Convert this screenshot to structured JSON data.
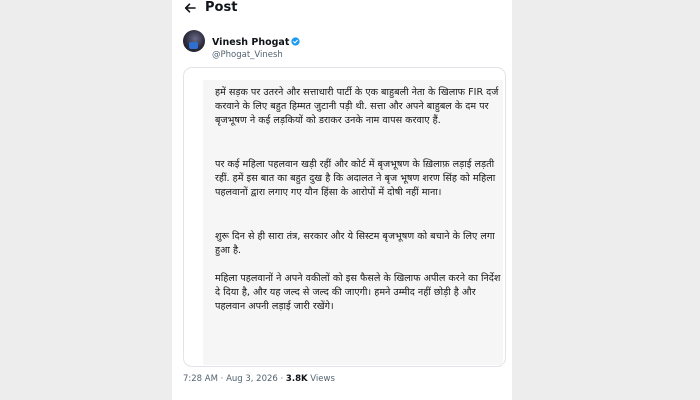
{
  "header": {
    "title": "Post"
  },
  "author": {
    "name": "Vinesh Phogat",
    "handle": "@Phogat_Vinesh"
  },
  "post": {
    "paragraphs": [
      "हमें सड़क पर उतरने और सत्ताधारी पार्टी के एक बाहुबली नेता के खिलाफ FIR दर्ज करवाने के लिए बहुत हिम्मत जुटानी पड़ी थी. सत्ता और अपने बाहुबल के दम पर बृजभूषण ने कई लड़कियों को डराकर उनके नाम वापस करवाए हैं.",
      "पर कई महिला पहलवान खड़ी रहीं और कोर्ट में बृजभूषण के ख़िलाफ़ लड़ाई लड़ती रहीं. हमें इस बात का बहुत दुख है कि अदालत ने बृज भूषण शरण सिंह को महिला पहलवानों द्वारा लगाए गए यौन हिंसा के आरोपों में दोषी नहीं माना।",
      "शुरू दिन से ही सारा तंत्र, सरकार और ये सिस्टम बृजभूषण को बचाने के लिए लगा हुआ है.",
      "महिला पहलवानों ने अपने वकीलों को इस फैसले के खिलाफ अपील करने का निर्देश दे दिया है, और यह जल्द से जल्द की जाएगी। हमने उम्मीद नहीं छोड़ी है और पहलवान अपनी लड़ाई जारी रखेंगे।"
    ]
  },
  "meta": {
    "time": "7:28 AM",
    "sep": " · ",
    "date": "Aug 3, 2026",
    "views_count": "3.8K",
    "views_label": " Views"
  },
  "colors": {
    "accent": "#1d9bf0",
    "text": "#0f1419",
    "muted": "#536471"
  },
  "icons": {
    "back": "arrow-left-icon",
    "verified": "verified-badge-icon"
  }
}
